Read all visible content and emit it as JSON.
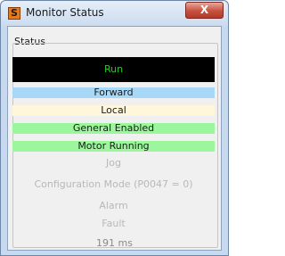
{
  "window": {
    "title": "Monitor Status",
    "app_icon_letter": "S",
    "close_label": "X"
  },
  "status_group": {
    "label": "Status",
    "run": "Run",
    "forward": "Forward",
    "local": "Local",
    "general_enabled": "General Enabled",
    "motor_running": "Motor Running",
    "jog": "Jog",
    "configuration_mode": "Configuration Mode (P0047 = 0)",
    "alarm": "Alarm",
    "fault": "Fault"
  },
  "timing": "191 ms",
  "colors": {
    "run_bg": "#000000",
    "run_text": "#20d020",
    "forward_bg": "#a8d8f8",
    "local_bg": "#fff6dc",
    "enabled_bg": "#9cf79c",
    "inactive_text": "#b8b8b8"
  }
}
